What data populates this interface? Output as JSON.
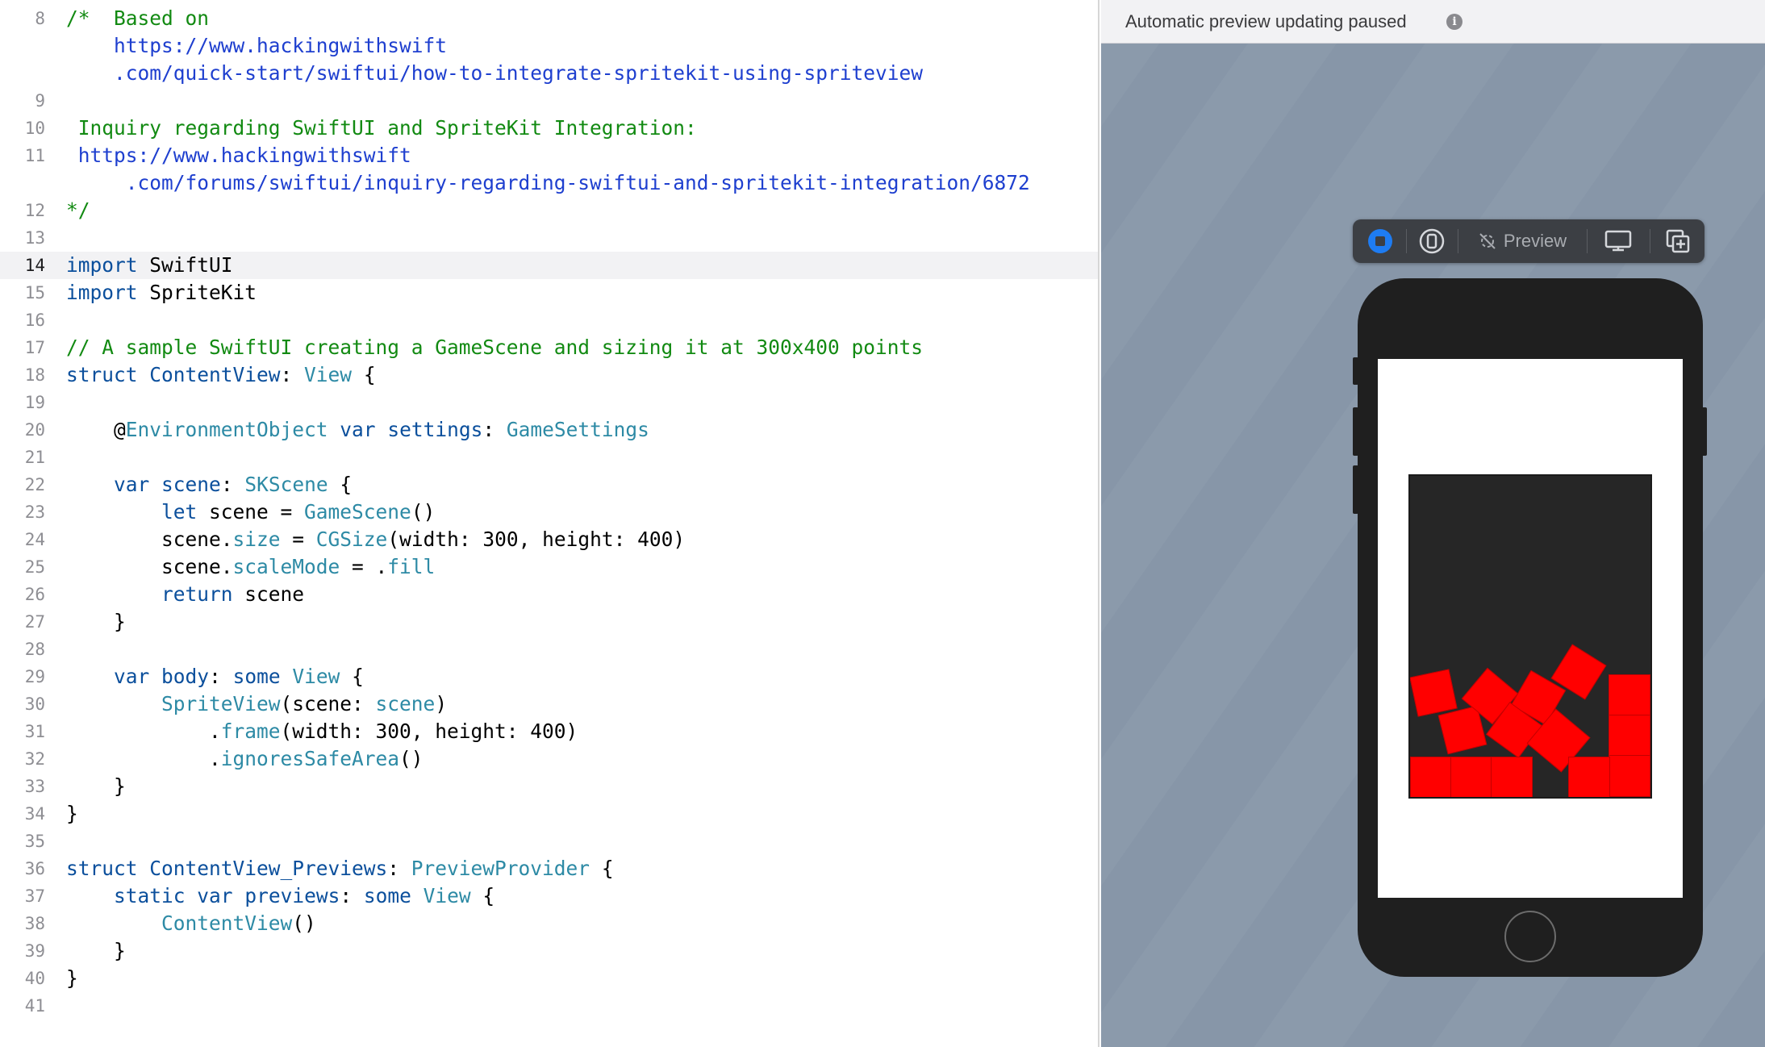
{
  "editor": {
    "current_line": "14",
    "lines": [
      {
        "n": "8",
        "segs": [
          {
            "t": "/*  Based on",
            "c": "cm"
          }
        ]
      },
      {
        "n": "",
        "segs": [
          {
            "t": "    https://www.hackingwithswift",
            "c": "url"
          }
        ]
      },
      {
        "n": "",
        "segs": [
          {
            "t": "    .com/quick-start/swiftui/how-to-integrate-spritekit-using-spriteview",
            "c": "url"
          }
        ]
      },
      {
        "n": "9",
        "segs": []
      },
      {
        "n": "10",
        "segs": [
          {
            "t": " Inquiry regarding SwiftUI and SpriteKit Integration:",
            "c": "cm"
          }
        ]
      },
      {
        "n": "11",
        "segs": [
          {
            "t": " https://www.hackingwithswift",
            "c": "url"
          }
        ]
      },
      {
        "n": "",
        "segs": [
          {
            "t": "     .com/forums/swiftui/inquiry-regarding-swiftui-and-spritekit-integration/6872",
            "c": "url"
          }
        ]
      },
      {
        "n": "12",
        "segs": [
          {
            "t": "*/",
            "c": "cm"
          }
        ]
      },
      {
        "n": "13",
        "segs": []
      },
      {
        "n": "14",
        "segs": [
          {
            "t": "import",
            "c": "kw"
          },
          {
            "t": " SwiftUI",
            "c": ""
          }
        ]
      },
      {
        "n": "15",
        "segs": [
          {
            "t": "import",
            "c": "kw"
          },
          {
            "t": " SpriteKit",
            "c": ""
          }
        ]
      },
      {
        "n": "16",
        "segs": []
      },
      {
        "n": "17",
        "segs": [
          {
            "t": "// A sample SwiftUI creating a GameScene and sizing it at 300x400 points",
            "c": "cm"
          }
        ]
      },
      {
        "n": "18",
        "segs": [
          {
            "t": "struct",
            "c": "kw"
          },
          {
            "t": " ContentView",
            "c": "kw"
          },
          {
            "t": ": ",
            "c": ""
          },
          {
            "t": "View",
            "c": "ty"
          },
          {
            "t": " {",
            "c": ""
          }
        ]
      },
      {
        "n": "19",
        "segs": []
      },
      {
        "n": "20",
        "segs": [
          {
            "t": "    @",
            "c": ""
          },
          {
            "t": "EnvironmentObject",
            "c": "ty"
          },
          {
            "t": " ",
            "c": ""
          },
          {
            "t": "var",
            "c": "kw"
          },
          {
            "t": " ",
            "c": ""
          },
          {
            "t": "settings",
            "c": "kw"
          },
          {
            "t": ": ",
            "c": ""
          },
          {
            "t": "GameSettings",
            "c": "ty"
          }
        ]
      },
      {
        "n": "21",
        "segs": []
      },
      {
        "n": "22",
        "segs": [
          {
            "t": "    ",
            "c": ""
          },
          {
            "t": "var",
            "c": "kw"
          },
          {
            "t": " ",
            "c": ""
          },
          {
            "t": "scene",
            "c": "kw"
          },
          {
            "t": ": ",
            "c": ""
          },
          {
            "t": "SKScene",
            "c": "ty"
          },
          {
            "t": " {",
            "c": ""
          }
        ]
      },
      {
        "n": "23",
        "segs": [
          {
            "t": "        ",
            "c": ""
          },
          {
            "t": "let",
            "c": "kw"
          },
          {
            "t": " scene = ",
            "c": ""
          },
          {
            "t": "GameScene",
            "c": "ty"
          },
          {
            "t": "()",
            "c": ""
          }
        ]
      },
      {
        "n": "24",
        "segs": [
          {
            "t": "        scene.",
            "c": ""
          },
          {
            "t": "size",
            "c": "ty"
          },
          {
            "t": " = ",
            "c": ""
          },
          {
            "t": "CGSize",
            "c": "ty"
          },
          {
            "t": "(width: 300, height: 400)",
            "c": ""
          }
        ]
      },
      {
        "n": "25",
        "segs": [
          {
            "t": "        scene.",
            "c": ""
          },
          {
            "t": "scaleMode",
            "c": "ty"
          },
          {
            "t": " = .",
            "c": ""
          },
          {
            "t": "fill",
            "c": "ty"
          }
        ]
      },
      {
        "n": "26",
        "segs": [
          {
            "t": "        ",
            "c": ""
          },
          {
            "t": "return",
            "c": "kw"
          },
          {
            "t": " scene",
            "c": ""
          }
        ]
      },
      {
        "n": "27",
        "segs": [
          {
            "t": "    }",
            "c": ""
          }
        ]
      },
      {
        "n": "28",
        "segs": []
      },
      {
        "n": "29",
        "segs": [
          {
            "t": "    ",
            "c": ""
          },
          {
            "t": "var",
            "c": "kw"
          },
          {
            "t": " ",
            "c": ""
          },
          {
            "t": "body",
            "c": "kw"
          },
          {
            "t": ": ",
            "c": ""
          },
          {
            "t": "some",
            "c": "kw"
          },
          {
            "t": " ",
            "c": ""
          },
          {
            "t": "View",
            "c": "ty"
          },
          {
            "t": " {",
            "c": ""
          }
        ]
      },
      {
        "n": "30",
        "segs": [
          {
            "t": "        ",
            "c": ""
          },
          {
            "t": "SpriteView",
            "c": "ty"
          },
          {
            "t": "(scene: ",
            "c": ""
          },
          {
            "t": "scene",
            "c": "ty"
          },
          {
            "t": ")",
            "c": ""
          }
        ]
      },
      {
        "n": "31",
        "segs": [
          {
            "t": "            .",
            "c": ""
          },
          {
            "t": "frame",
            "c": "ty"
          },
          {
            "t": "(width: 300, height: 400)",
            "c": ""
          }
        ]
      },
      {
        "n": "32",
        "segs": [
          {
            "t": "            .",
            "c": ""
          },
          {
            "t": "ignoresSafeArea",
            "c": "ty"
          },
          {
            "t": "()",
            "c": ""
          }
        ]
      },
      {
        "n": "33",
        "segs": [
          {
            "t": "    }",
            "c": ""
          }
        ]
      },
      {
        "n": "34",
        "segs": [
          {
            "t": "}",
            "c": ""
          }
        ]
      },
      {
        "n": "35",
        "segs": []
      },
      {
        "n": "36",
        "segs": [
          {
            "t": "struct",
            "c": "kw"
          },
          {
            "t": " ContentView_Previews",
            "c": "kw"
          },
          {
            "t": ": ",
            "c": ""
          },
          {
            "t": "PreviewProvider",
            "c": "ty"
          },
          {
            "t": " {",
            "c": ""
          }
        ]
      },
      {
        "n": "37",
        "segs": [
          {
            "t": "    ",
            "c": ""
          },
          {
            "t": "static",
            "c": "kw"
          },
          {
            "t": " ",
            "c": ""
          },
          {
            "t": "var",
            "c": "kw"
          },
          {
            "t": " ",
            "c": ""
          },
          {
            "t": "previews",
            "c": "kw"
          },
          {
            "t": ": ",
            "c": ""
          },
          {
            "t": "some",
            "c": "kw"
          },
          {
            "t": " ",
            "c": ""
          },
          {
            "t": "View",
            "c": "ty"
          },
          {
            "t": " {",
            "c": ""
          }
        ]
      },
      {
        "n": "38",
        "segs": [
          {
            "t": "        ",
            "c": ""
          },
          {
            "t": "ContentView",
            "c": "ty"
          },
          {
            "t": "()",
            "c": ""
          }
        ]
      },
      {
        "n": "39",
        "segs": [
          {
            "t": "    }",
            "c": ""
          }
        ]
      },
      {
        "n": "40",
        "segs": [
          {
            "t": "}",
            "c": ""
          }
        ]
      },
      {
        "n": "41",
        "segs": []
      }
    ]
  },
  "preview": {
    "status": "Automatic preview updating paused",
    "info_icon": "info-icon",
    "toolbar": {
      "live_icon": "live-preview-icon",
      "variants_icon": "device-variants-icon",
      "preview_label": "Preview",
      "preview_icon": "preview-disabled-icon",
      "device_settings_icon": "device-settings-icon",
      "duplicate_icon": "duplicate-preview-icon"
    }
  },
  "colors": {
    "keyword": "#0b4f9c",
    "type": "#2d8aa5",
    "comment": "#128a12",
    "url": "#1e3fcf",
    "canvas": "#8796a8",
    "scene_background": "#262626",
    "box": "#ff0000"
  }
}
